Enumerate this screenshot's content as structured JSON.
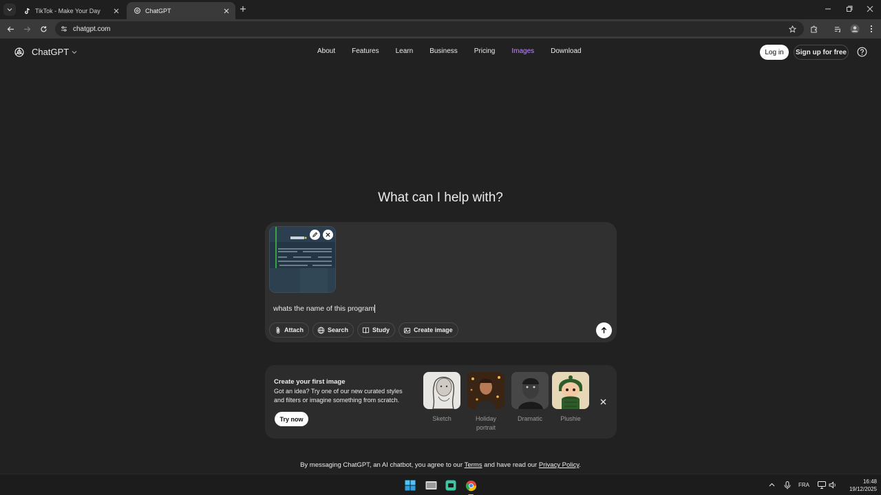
{
  "browser": {
    "tabs": [
      {
        "title": "TikTok - Make Your Day",
        "active": false,
        "favicon": "tiktok-icon"
      },
      {
        "title": "ChatGPT",
        "active": true,
        "favicon": "openai-icon"
      }
    ],
    "url": "chatgpt.com"
  },
  "header": {
    "brand": "ChatGPT",
    "nav": [
      "About",
      "Features",
      "Learn",
      "Business",
      "Pricing",
      "Images",
      "Download"
    ],
    "nav_highlight": "Images",
    "login_label": "Log in",
    "signup_label": "Sign up for free"
  },
  "hero": {
    "title": "What can I help with?"
  },
  "composer": {
    "prompt_value": "whats the name of this program",
    "chips": [
      {
        "label": "Attach",
        "icon": "paperclip-icon"
      },
      {
        "label": "Search",
        "icon": "globe-icon"
      },
      {
        "label": "Study",
        "icon": "book-icon"
      },
      {
        "label": "Create image",
        "icon": "image-icon"
      }
    ]
  },
  "promo": {
    "title": "Create your first image",
    "description": "Got an idea? Try one of our new curated styles and filters or imagine something from scratch.",
    "button": "Try now",
    "styles": [
      {
        "label": "Sketch"
      },
      {
        "label": "Holiday portrait"
      },
      {
        "label": "Dramatic"
      },
      {
        "label": "Plushie"
      }
    ]
  },
  "footer": {
    "before": "By messaging ChatGPT, an AI chatbot, you agree to our ",
    "terms": "Terms",
    "middle": " and have read our ",
    "privacy": "Privacy Policy",
    "after": "."
  },
  "taskbar": {
    "language": "FRA",
    "time": "16:48",
    "date": "19/12/2025"
  },
  "colors": {
    "page_bg": "#212121",
    "composer_bg": "#303030",
    "nav_highlight": "#c28cf5"
  }
}
